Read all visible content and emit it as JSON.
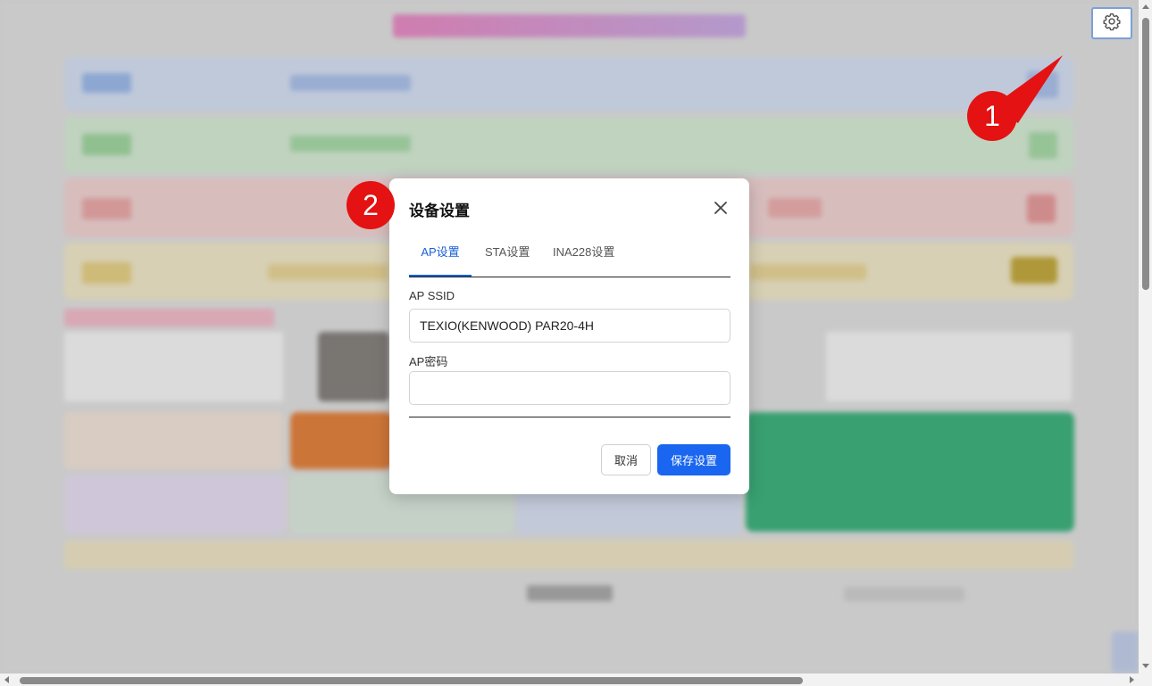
{
  "modal": {
    "title": "设备设置",
    "tabs": [
      {
        "label": "AP设置",
        "active": true
      },
      {
        "label": "STA设置",
        "active": false
      },
      {
        "label": "INA228设置",
        "active": false
      }
    ],
    "ssid_label": "AP SSID",
    "ssid_value": "TEXIO(KENWOOD) PAR20-4H",
    "password_label": "AP密码",
    "password_value": "",
    "cancel_label": "取消",
    "save_label": "保存设置"
  },
  "callouts": [
    "1",
    "2"
  ],
  "icons": {
    "settings": "gear-icon",
    "close": "close-icon"
  },
  "colors": {
    "accent": "#1a66f0",
    "callout": "#e41212",
    "active_tab": "#1a5fd6"
  }
}
